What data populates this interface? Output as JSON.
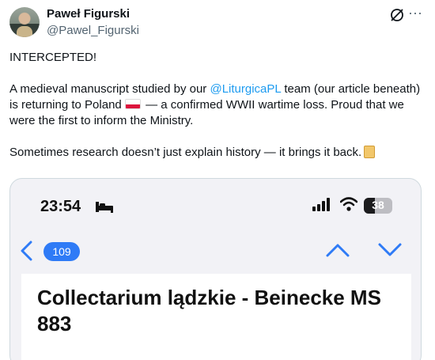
{
  "author": {
    "name": "Paweł Figurski",
    "handle": "@Pawel_Figurski",
    "avatar_icon": "avatar-photo"
  },
  "actions": {
    "grok_icon": "grok-icon",
    "more_label": "···"
  },
  "tweet": {
    "line1": "INTERCEPTED!",
    "p2_a": "A medieval manuscript studied by our ",
    "p2_mention": "@LiturgicaPL",
    "p2_b": " team (our article beneath) is returning to Poland ",
    "p2_c": " — a confirmed WWII wartime loss. Proud that we were the first to inform the Ministry.",
    "p3": "Sometimes research doesn’t just explain history — it brings it back.",
    "emoji_flag": "flag-poland",
    "emoji_scroll": "scroll-emoji"
  },
  "media": {
    "status_time": "23:54",
    "battery_percent": "38",
    "battery_level": 0.38,
    "message_count": "109",
    "document_title": "Collectarium lądzkie - Beinecke MS 883"
  },
  "colors": {
    "link": "#1d9bf0",
    "badge": "#2f7bf6",
    "chevron": "#2f7bf6"
  }
}
